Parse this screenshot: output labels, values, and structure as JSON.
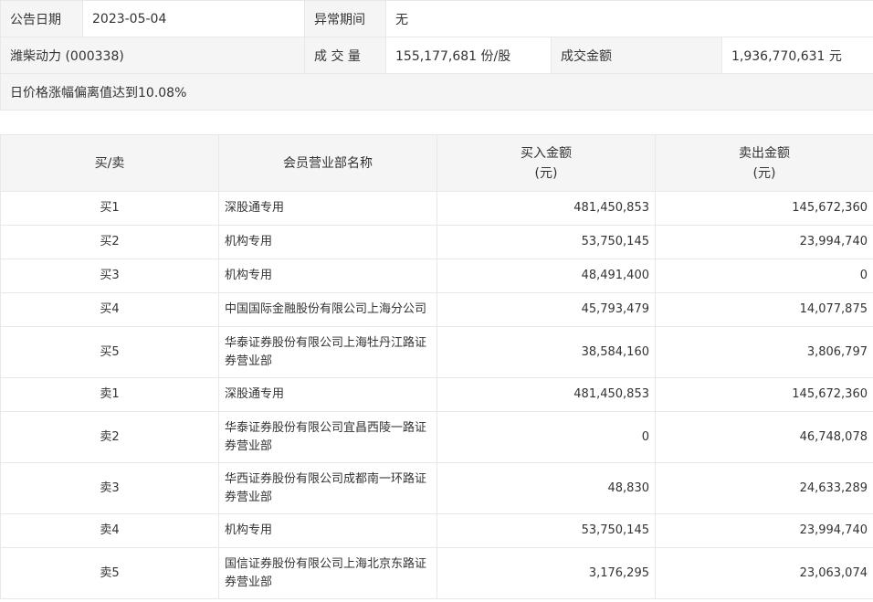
{
  "info": {
    "date_label": "公告日期",
    "date_value": "2023-05-04",
    "period_label": "异常期间",
    "period_value": "无",
    "stock_name": "潍柴动力 (000338)",
    "volume_label": "成 交 量",
    "volume_value": "155,177,681 份/股",
    "amount_label": "成交金额",
    "amount_value": "1,936,770,631 元",
    "reason": "日价格涨幅偏离值达到10.08%"
  },
  "table": {
    "headers": {
      "side": "买/卖",
      "member": "会员营业部名称",
      "buy": "买入金额",
      "buy_unit": "(元)",
      "sell": "卖出金额",
      "sell_unit": "(元)"
    },
    "rows": [
      {
        "side": "买1",
        "member": "深股通专用",
        "buy": "481,450,853",
        "sell": "145,672,360"
      },
      {
        "side": "买2",
        "member": "机构专用",
        "buy": "53,750,145",
        "sell": "23,994,740"
      },
      {
        "side": "买3",
        "member": "机构专用",
        "buy": "48,491,400",
        "sell": "0"
      },
      {
        "side": "买4",
        "member": "中国国际金融股份有限公司上海分公司",
        "buy": "45,793,479",
        "sell": "14,077,875"
      },
      {
        "side": "买5",
        "member": "华泰证券股份有限公司上海牡丹江路证券营业部",
        "buy": "38,584,160",
        "sell": "3,806,797"
      },
      {
        "side": "卖1",
        "member": "深股通专用",
        "buy": "481,450,853",
        "sell": "145,672,360"
      },
      {
        "side": "卖2",
        "member": "华泰证券股份有限公司宜昌西陵一路证券营业部",
        "buy": "0",
        "sell": "46,748,078"
      },
      {
        "side": "卖3",
        "member": "华西证券股份有限公司成都南一环路证券营业部",
        "buy": "48,830",
        "sell": "24,633,289"
      },
      {
        "side": "卖4",
        "member": "机构专用",
        "buy": "53,750,145",
        "sell": "23,994,740"
      },
      {
        "side": "卖5",
        "member": "国信证券股份有限公司上海北京东路证券营业部",
        "buy": "3,176,295",
        "sell": "23,063,074"
      }
    ]
  }
}
